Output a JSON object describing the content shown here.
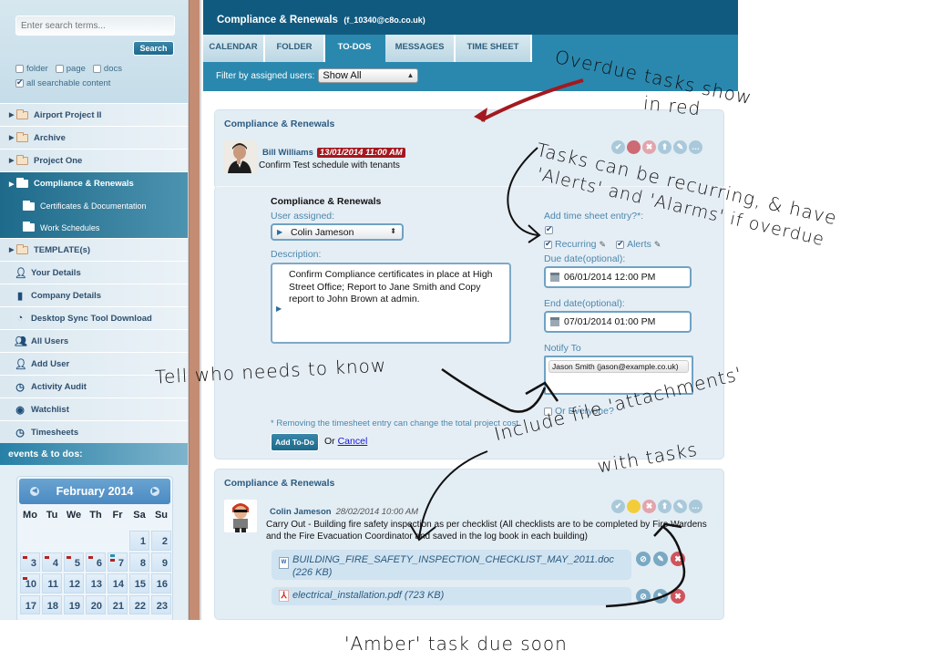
{
  "sidebar": {
    "search": {
      "placeholder": "Enter search terms...",
      "button": "Search"
    },
    "filters": [
      {
        "label": "folder",
        "checked": false
      },
      {
        "label": "page",
        "checked": false
      },
      {
        "label": "docs",
        "checked": false
      },
      {
        "label": "all searchable content",
        "checked": true
      }
    ],
    "folders": [
      {
        "label": "Airport Project II",
        "icon": "folder-icon"
      },
      {
        "label": "Archive",
        "icon": "folder-icon"
      },
      {
        "label": "Project One",
        "icon": "folder-icon"
      },
      {
        "label": "Compliance & Renewals",
        "icon": "folder-icon",
        "active": true
      },
      {
        "label": "Certificates & Documentation",
        "icon": "folder-icon"
      },
      {
        "label": "Work Schedules",
        "icon": "folder-icon"
      },
      {
        "label": "TEMPLATE(s)",
        "icon": "folder-icon"
      }
    ],
    "links": [
      {
        "label": "Your Details",
        "icon": "user-icon"
      },
      {
        "label": "Company Details",
        "icon": "bookmark-icon"
      },
      {
        "label": "Desktop Sync Tool Download",
        "icon": "sync-icon"
      },
      {
        "label": "All Users",
        "icon": "users-icon"
      },
      {
        "label": "Add User",
        "icon": "add-user-icon"
      },
      {
        "label": "Activity Audit",
        "icon": "clock-icon"
      },
      {
        "label": "Watchlist",
        "icon": "watchlist-icon"
      },
      {
        "label": "Timesheets",
        "icon": "clock-icon"
      }
    ],
    "events_header": "events & to dos:",
    "calendar": {
      "month": "February 2014",
      "weekdays": [
        "Mo",
        "Tu",
        "We",
        "Th",
        "Fr",
        "Sa",
        "Su"
      ],
      "leading_blanks": 5,
      "days": [
        "1",
        "2",
        "3",
        "4",
        "5",
        "6",
        "7",
        "8",
        "9",
        "10",
        "11",
        "12",
        "13",
        "14",
        "15",
        "16",
        "17",
        "18",
        "19",
        "20",
        "21",
        "22",
        "23"
      ],
      "overdue_marked_days": [
        "3",
        "4",
        "5",
        "6",
        "7",
        "10"
      ],
      "other_marked_days": [
        "7"
      ]
    }
  },
  "header": {
    "title": "Compliance & Renewals",
    "email": "(f_10340@c8o.co.uk)"
  },
  "tabs": [
    {
      "label": "CALENDAR",
      "active": false
    },
    {
      "label": "FOLDER",
      "active": false
    },
    {
      "label": "TO-DOS",
      "active": true
    },
    {
      "label": "MESSAGES",
      "active": false
    },
    {
      "label": "TIME SHEET",
      "active": false
    }
  ],
  "filter": {
    "label": "Filter by assigned users:",
    "value": "Show All"
  },
  "task1": {
    "folder": "Compliance & Renewals",
    "user": "Bill Williams",
    "due": "13/01/2014 11:00 AM",
    "status": "overdue",
    "text": "Confirm Test schedule with tenants",
    "status_color": "#cd6a73"
  },
  "form": {
    "title": "Compliance & Renewals",
    "user_label": "User assigned:",
    "user_value": "Colin Jameson",
    "description_label": "Description:",
    "description": "Confirm Compliance certificates in place at High Street Office; Report to Jane Smith and Copy report to John Brown at admin.",
    "timesheet_label": "Add time sheet entry?*:",
    "timesheet_checked": true,
    "recurring_label": "Recurring",
    "recurring_checked": true,
    "alerts_label": "Alerts",
    "alerts_checked": true,
    "due_label": "Due date(optional):",
    "due_value": "06/01/2014 12:00 PM",
    "end_label": "End date(optional):",
    "end_value": "07/01/2014 01:00 PM",
    "notify_label": "Notify To",
    "notify_value": "Jason Smith (jason@example.co.uk)",
    "everyone_label": "Or Everyone?",
    "everyone_checked": false,
    "note": "* Removing the timesheet entry can change the total project cost",
    "submit": "Add To-Do",
    "or": "Or",
    "cancel": "Cancel"
  },
  "task2": {
    "folder": "Compliance & Renewals",
    "user": "Colin Jameson",
    "due": "28/02/2014 10:00 AM",
    "status": "due-soon",
    "status_color": "#f3cc3a",
    "text": "Carry Out - Building fire safety inspection as per checklist (All checklists are to be completed by Fire Wardens and the Fire Evacuation Coordinator and saved in the log book in each building)",
    "attachments": [
      {
        "name": "BUILDING_FIRE_SAFETY_INSPECTION_CHECKLIST_MAY_2011.doc (226 KB)",
        "type": "doc"
      },
      {
        "name": "electrical_installation.pdf (723 KB)",
        "type": "pdf"
      }
    ]
  },
  "annotations": {
    "overdue": [
      "Overdue tasks show",
      "in red"
    ],
    "recurring": [
      "Tasks can be recurring, & have",
      "'Alerts' and 'Alarms' if overdue"
    ],
    "notify": "Tell who needs to know",
    "attachments": [
      "Include file 'attachments'",
      "with tasks"
    ],
    "amber": "'Amber' task due soon"
  }
}
